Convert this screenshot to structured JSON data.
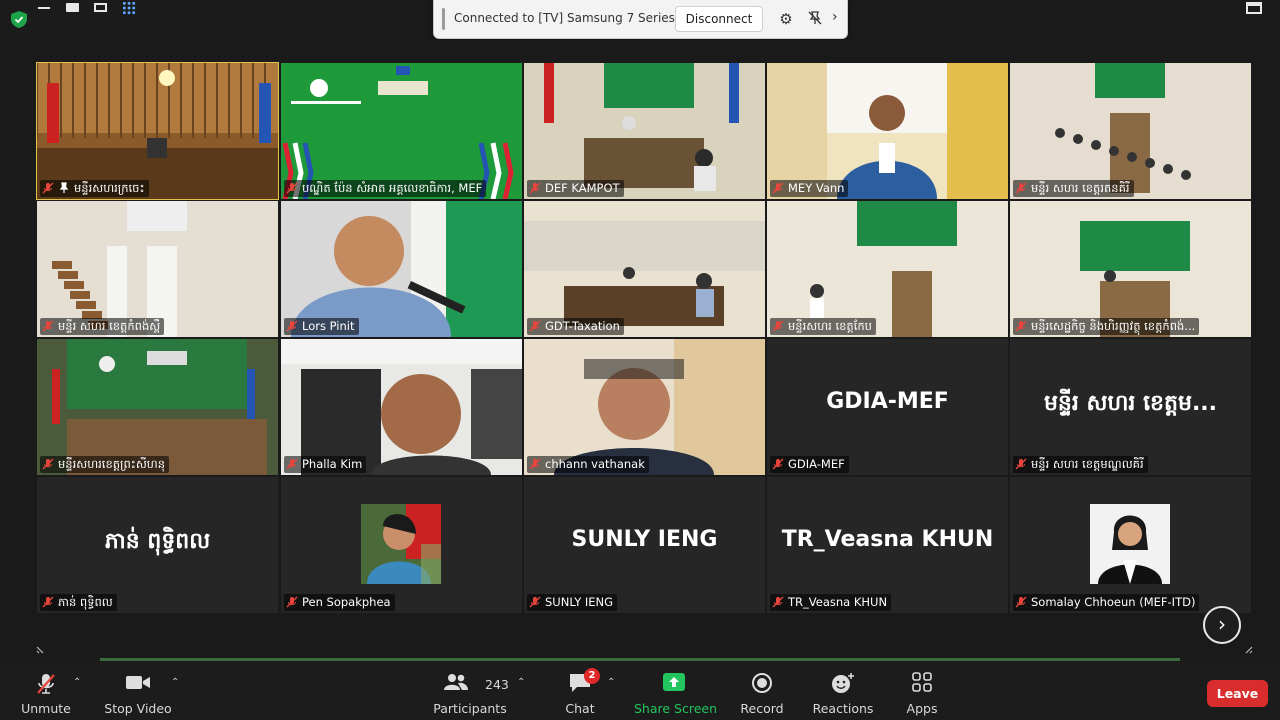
{
  "cast_banner": {
    "text": "Connected to [TV] Samsung 7 Series (65",
    "disconnect_label": "Disconnect"
  },
  "tiles": [
    {
      "name": "មន្ទីរសហរក្រចេះ",
      "muted": true,
      "pinned": true,
      "active": true,
      "video": "hall"
    },
    {
      "name": "បណ្ឌិត ប៉ែន សំអាត អគ្គលេខាធិការ, MEF",
      "muted": true,
      "video": "green"
    },
    {
      "name": "DEF KAMPOT",
      "muted": true,
      "video": "conf"
    },
    {
      "name": "MEY Vann",
      "muted": true,
      "video": "man-window"
    },
    {
      "name": "មន្ទីរ សហរ ខេត្តរតនគិរី",
      "muted": true,
      "video": "room-green"
    },
    {
      "name": "មន្ទីរ សហរ ខេត្តកំពង់ស្ពឺ",
      "muted": true,
      "video": "long-room"
    },
    {
      "name": "Lors Pinit",
      "muted": true,
      "video": "speaker"
    },
    {
      "name": "GDT-Taxation",
      "muted": true,
      "video": "conf2"
    },
    {
      "name": "មន្ទីរសហរ ខេត្តកែប",
      "muted": true,
      "video": "room-green2"
    },
    {
      "name": "មន្ទីរសេដ្ឋកិច្ច និងហិរញ្ញវត្ថុ ខេត្តកំពង់...",
      "muted": true,
      "video": "room-green3"
    },
    {
      "name": "មន្ទីរសហរខេត្តព្រះសីហនុ",
      "muted": true,
      "video": "green-hall"
    },
    {
      "name": "Phalla Kim",
      "muted": true,
      "video": "man-down"
    },
    {
      "name": "chhann vathanak",
      "muted": true,
      "video": "man-office"
    },
    {
      "name": "GDIA-MEF",
      "muted": true,
      "display": "GDIA-MEF"
    },
    {
      "name": "មន្ទីរ សហរ ខេត្តមណ្ឌលគិរី",
      "muted": true,
      "display": "មន្ទីរ សហរ ខេត្តម..."
    },
    {
      "name": "ភាន់ ពុទ្ធិពល",
      "muted": true,
      "display": "ភាន់ ពុទ្ធិពល"
    },
    {
      "name": "Pen Sopakphea",
      "muted": true,
      "photo": "woman-portrait"
    },
    {
      "name": "SUNLY IENG",
      "muted": true,
      "display": "SUNLY IENG"
    },
    {
      "name": "TR_Veasna KHUN",
      "muted": true,
      "display": "TR_Veasna KHUN"
    },
    {
      "name": "Somalay Chhoeun (MEF-ITD)",
      "muted": true,
      "photo": "woman-formal"
    }
  ],
  "toolbar": {
    "unmute": "Unmute",
    "stop_video": "Stop Video",
    "participants": "Participants",
    "participant_count": "243",
    "chat": "Chat",
    "chat_badge": "2",
    "share_screen": "Share Screen",
    "record": "Record",
    "reactions": "Reactions",
    "apps": "Apps",
    "leave": "Leave"
  },
  "colors": {
    "share_green": "#22c55e",
    "leave_red": "#d92c2c",
    "active_outline": "#e3c44a",
    "muted_red": "#e8453c"
  }
}
